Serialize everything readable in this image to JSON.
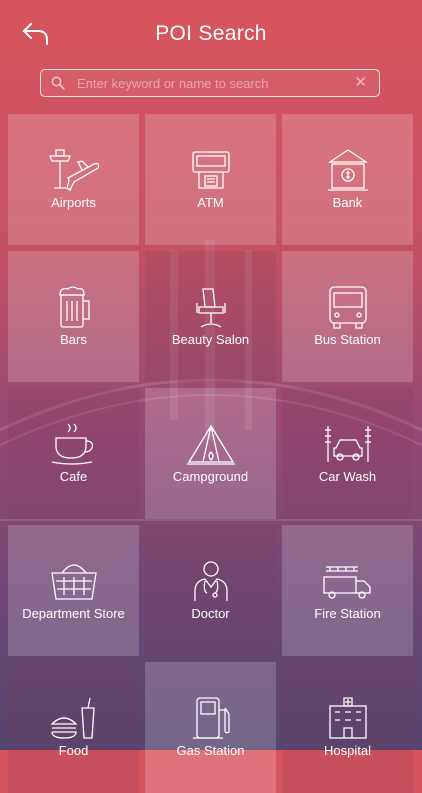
{
  "header": {
    "title": "POI Search"
  },
  "search": {
    "placeholder": "Enter keyword or name to search",
    "value": ""
  },
  "categories": [
    {
      "label": "Airports",
      "icon": "airport-icon"
    },
    {
      "label": "ATM",
      "icon": "atm-icon"
    },
    {
      "label": "Bank",
      "icon": "bank-icon"
    },
    {
      "label": "Bars",
      "icon": "beer-mug-icon"
    },
    {
      "label": "Beauty Salon",
      "icon": "salon-chair-icon"
    },
    {
      "label": "Bus Station",
      "icon": "bus-icon"
    },
    {
      "label": "Cafe",
      "icon": "coffee-cup-icon"
    },
    {
      "label": "Campground",
      "icon": "tent-icon"
    },
    {
      "label": "Car Wash",
      "icon": "car-wash-icon"
    },
    {
      "label": "Department Store",
      "icon": "shopping-basket-icon"
    },
    {
      "label": "Doctor",
      "icon": "doctor-icon"
    },
    {
      "label": "Fire Station",
      "icon": "fire-truck-icon"
    },
    {
      "label": "Food",
      "icon": "fast-food-icon"
    },
    {
      "label": "Gas Station",
      "icon": "gas-pump-icon"
    },
    {
      "label": "Hospital",
      "icon": "hospital-icon"
    }
  ]
}
